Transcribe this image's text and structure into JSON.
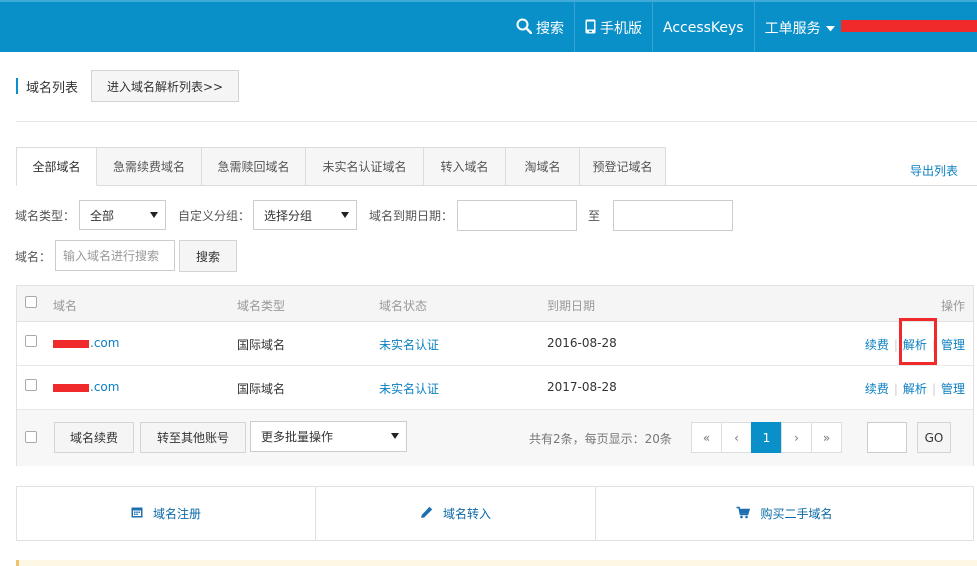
{
  "topbar": {
    "search": "搜索",
    "mobile": "手机版",
    "access_keys": "AccessKeys",
    "ticket_service": "工单服务"
  },
  "title": {
    "label": "域名列表",
    "dns_list_button": "进入域名解析列表>>"
  },
  "tabs": [
    {
      "label": "全部域名",
      "active": true
    },
    {
      "label": "急需续费域名"
    },
    {
      "label": "急需赎回域名"
    },
    {
      "label": "未实名认证域名"
    },
    {
      "label": "转入域名"
    },
    {
      "label": "淘域名"
    },
    {
      "label": "预登记域名"
    }
  ],
  "export_link": "导出列表",
  "filters": {
    "type_label": "域名类型：",
    "type_value": "全部",
    "group_label": "自定义分组：",
    "group_value": "选择分组",
    "expiry_label": "域名到期日期：",
    "to_label": "至",
    "name_label": "域名：",
    "name_placeholder": "输入域名进行搜索",
    "search_button": "搜索"
  },
  "table": {
    "headers": [
      "域名",
      "域名类型",
      "域名状态",
      "到期日期",
      "操作"
    ],
    "rows": [
      {
        "domain_suffix": ".com",
        "type": "国际域名",
        "status": "未实名认证",
        "expiry": "2016-08-28"
      },
      {
        "domain_suffix": ".com",
        "type": "国际域名",
        "status": "未实名认证",
        "expiry": "2017-08-28"
      }
    ],
    "ops": {
      "renew": "续费",
      "resolve": "解析",
      "manage": "管理"
    },
    "footer": {
      "renew_button": "域名续费",
      "transfer_button": "转至其他账号",
      "batch_select": "更多批量操作",
      "summary": "共有2条，每页显示：20条",
      "pager": [
        "«",
        "‹",
        "1",
        "›",
        "»"
      ],
      "current_page": "1",
      "go_button": "GO"
    }
  },
  "actions": {
    "register": "域名注册",
    "transfer_in": "域名转入",
    "buy_second_hand": "购买二手域名"
  },
  "colors": {
    "brand": "#0a90c9",
    "link": "#0a7fc2",
    "highlight": "#f02a2a"
  }
}
